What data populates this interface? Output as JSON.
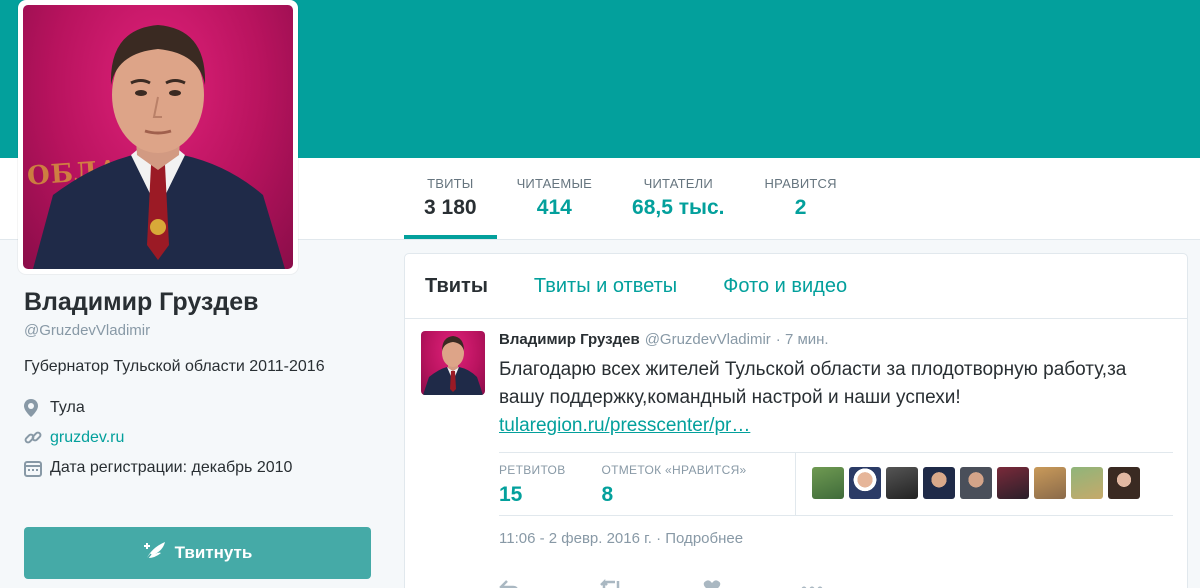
{
  "profile": {
    "name": "Владимир Груздев",
    "handle": "@GruzdevVladimir",
    "bio": "Губернатор Тульской области 2011-2016",
    "location": "Тула",
    "website": "gruzdev.ru",
    "joined": "Дата регистрации: декабрь 2010",
    "avatar_text": "ОБЛАСТ"
  },
  "stats": [
    {
      "label": "ТВИТЫ",
      "value": "3 180"
    },
    {
      "label": "ЧИТАЕМЫЕ",
      "value": "414"
    },
    {
      "label": "ЧИТАТЕЛИ",
      "value": "68,5 тыс."
    },
    {
      "label": "НРАВИТСЯ",
      "value": "2"
    }
  ],
  "tabs": [
    "Твиты",
    "Твиты и ответы",
    "Фото и видео"
  ],
  "tweet_button": "Твитнуть",
  "tweet": {
    "name": "Владимир Груздев",
    "handle": "@GruzdevVladimir",
    "time": "· 7 мин.",
    "text": "Благодарю всех жителей Тульской области за плодотворную работу,за вашу поддержку,командный настрой и наши успехи!",
    "link": "tularegion.ru/presscenter/pr…",
    "retweets_label": "РЕТВИТОВ",
    "retweets": "15",
    "likes_label": "ОТМЕТОК «НРАВИТСЯ»",
    "likes": "8",
    "date": "11:06 - 2 февр. 2016 г. · Подробнее"
  },
  "colors": {
    "accent": "#03a09c",
    "banner": "#03a09c",
    "button": "#45aaa7",
    "text": "#292f33",
    "muted": "#8899a6"
  },
  "icons": [
    "location-pin-icon",
    "link-icon",
    "calendar-icon",
    "quill-icon",
    "reply-icon",
    "retweet-icon",
    "heart-icon",
    "more-icon"
  ]
}
